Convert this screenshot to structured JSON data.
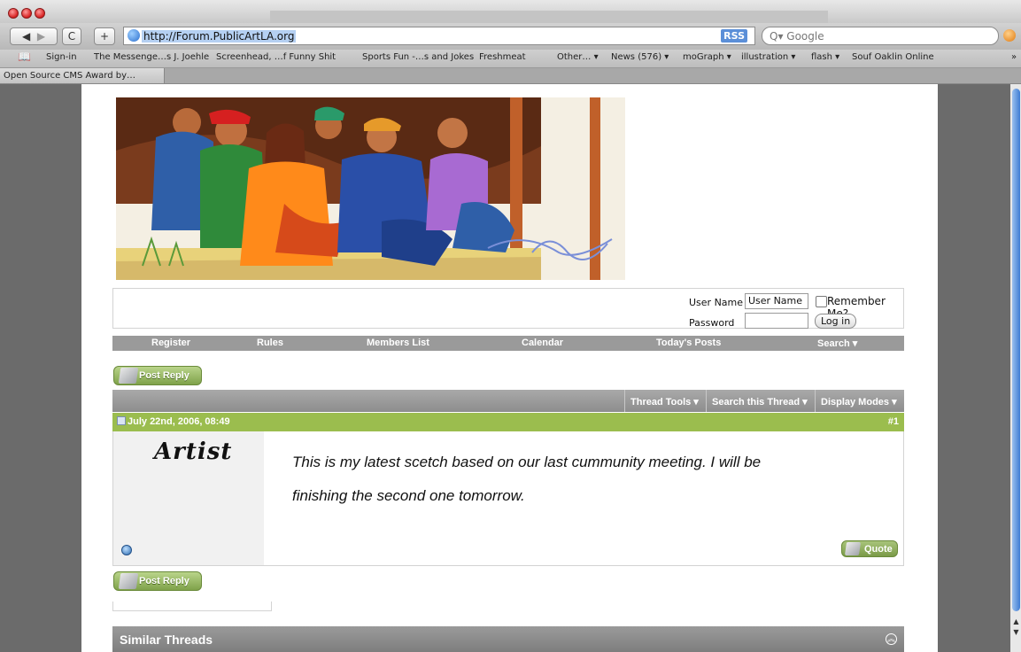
{
  "browser": {
    "url": "http://Forum.PublicArtLA.org",
    "rss_label": "RSS",
    "search_placeholder": "Q▾ Google",
    "bookmarks": [
      "Sign-in",
      "The Messenge…s J. Joehle",
      "Screenhead, …f Funny Shit",
      "Sports Fun -…s and Jokes",
      "Freshmeat",
      "Other… ▾",
      "News (576) ▾",
      "moGraph ▾",
      "illustration ▾",
      "flash ▾",
      "Souf Oaklin Online"
    ],
    "bookmarks_more": "»",
    "tab_title": "Open Source CMS Award by…"
  },
  "login": {
    "username_label": "User Name",
    "username_value": "User Name",
    "remember_label": "Remember Me?",
    "password_label": "Password",
    "login_button": "Log in"
  },
  "nav": {
    "items": [
      "Register",
      "Rules",
      "Members List",
      "Calendar",
      "Today's Posts",
      "Search ▾"
    ]
  },
  "thread": {
    "post_reply_label": "Post Reply",
    "tools": [
      "Thread Tools ▾",
      "Search this Thread ▾",
      "Display Modes ▾"
    ]
  },
  "post": {
    "date": "July 22nd, 2006, 08:49",
    "number": "#1",
    "username": "Artist",
    "text_line1": "This is my latest scetch based on our last cummunity meeting. I will be",
    "text_line2": "finishing the second one tomorrow.",
    "quote_label": "Quote"
  },
  "similar_threads": {
    "title": "Similar Threads"
  }
}
